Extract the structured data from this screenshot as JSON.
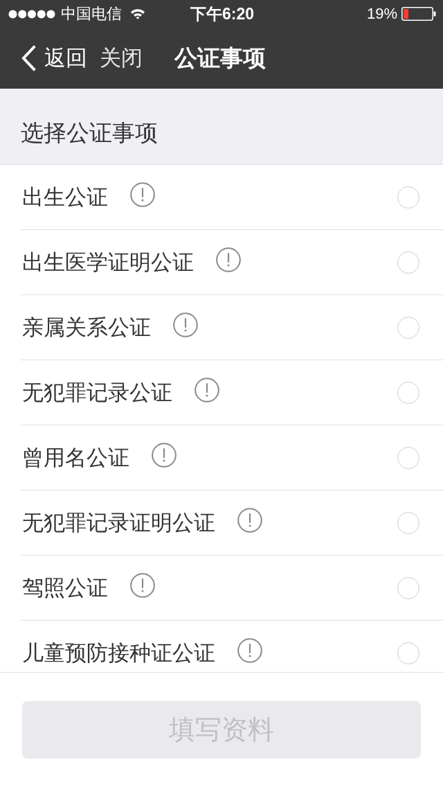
{
  "status_bar": {
    "carrier": "中国电信",
    "time": "下午6:20",
    "battery": "19%"
  },
  "nav_bar": {
    "back": "返回",
    "close": "关闭",
    "title": "公证事项"
  },
  "section_header": "选择公证事项",
  "items": [
    {
      "label": "出生公证",
      "selected": false
    },
    {
      "label": "出生医学证明公证",
      "selected": false
    },
    {
      "label": "亲属关系公证",
      "selected": false
    },
    {
      "label": "无犯罪记录公证",
      "selected": false
    },
    {
      "label": "曾用名公证",
      "selected": false
    },
    {
      "label": "无犯罪记录证明公证",
      "selected": false
    },
    {
      "label": "驾照公证",
      "selected": false
    },
    {
      "label": "儿童预防接种证公证",
      "selected": false
    }
  ],
  "footer": {
    "button": {
      "label": "填写资料",
      "disabled": true
    }
  }
}
